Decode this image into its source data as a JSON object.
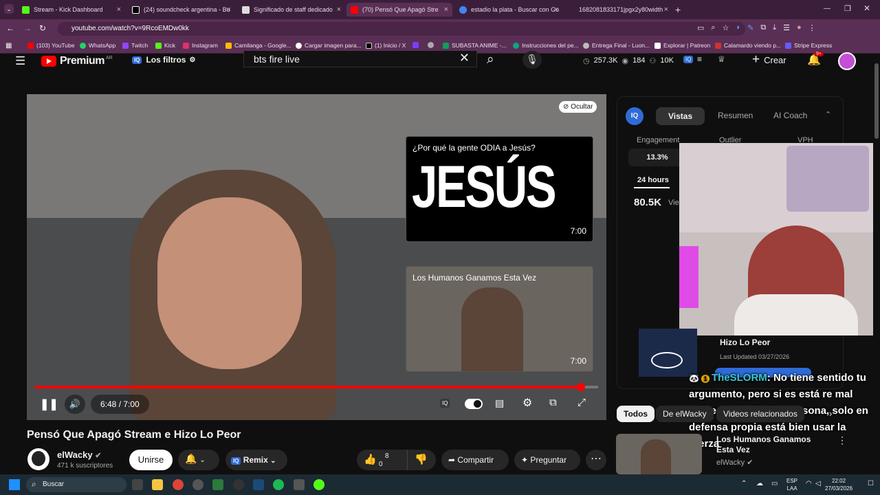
{
  "browser": {
    "tabs": [
      {
        "label": "Stream - Kick Dashboard",
        "color": "#53fc18"
      },
      {
        "label": "(24) soundcheck argentina - Bu",
        "color": "#000000"
      },
      {
        "label": "Significado de staff dedicado",
        "color": "#ffffff"
      },
      {
        "label": "(70) Pensó Que Apagó Stre",
        "color": "#ff0000"
      },
      {
        "label": "estadio la plata - Buscar con Go",
        "color": "#4285f4"
      },
      {
        "label": "1682081833171jpgx2y80width",
        "color": "#888888"
      }
    ],
    "url": "youtube.com/watch?v=9RcoEMDw0kk",
    "bookmarks": [
      "(103) YouTube",
      "WhatsApp",
      "Twitch",
      "Kick",
      "Instagram",
      "Camilanga - Google...",
      "Cargar imagen para...",
      "(1) Inicio / X",
      "",
      "",
      "SUBASTA ANIME -...",
      "Instrucciones del pe...",
      "Entrega Final - Luon...",
      "Explorar | Patreon",
      "Calamardo viendo p...",
      "Stripe Express"
    ]
  },
  "yt": {
    "premium": "Premium",
    "region": "AR",
    "filters": "Los filtros",
    "search_value": "bts fire live",
    "stats": {
      "s1": "257.3K",
      "s2": "184",
      "s3": "10K"
    },
    "create": "Crear",
    "notif": "9+",
    "hide": "Ocultar",
    "endcard1": {
      "title": "¿Por qué la gente ODIA a Jesús?",
      "big": "JESÚS",
      "duration": "7:00"
    },
    "endcard2": {
      "title": "Los Humanos Ganamos Esta Vez",
      "duration": "7:00"
    },
    "time": "6:48 / 7:00",
    "progress": 0.97,
    "video_title": "Pensó Que Apagó Stream e Hizo Lo Peor",
    "channel": "elWacky",
    "subs": "471 k suscriptores",
    "join": "Unirse",
    "remix": "Remix",
    "likes": "8",
    "dislikes": "0",
    "share": "Compartir",
    "ask": "Preguntar"
  },
  "side": {
    "tabs": [
      "Vistas",
      "Resumen",
      "AI Coach"
    ],
    "metrics": [
      "Engagement",
      "Outlier",
      "VPH"
    ],
    "engagement": "13.3%",
    "period": "24 hours",
    "views": "80.5K",
    "views_suffix": "Vie",
    "card_title": "Hizo Lo Peor",
    "card_updated": "Last Updated 03/27/2026",
    "chips": [
      "Todos",
      "De elWacky",
      "Videos relacionados"
    ],
    "rec_title": "Los Humanos Ganamos Esta Vez",
    "rec_channel": "elWacky"
  },
  "chat": {
    "user": "TheSLORM",
    "message": ": No tiene sentido tu argumento, pero si es está re mal golpear a cualquier persona, solo en defensa propia está bien usar la fuerza"
  },
  "taskbar": {
    "search": "Buscar",
    "lang1": "ESP",
    "lang2": "LAA",
    "time": "22:02",
    "date": "27/03/2026"
  }
}
